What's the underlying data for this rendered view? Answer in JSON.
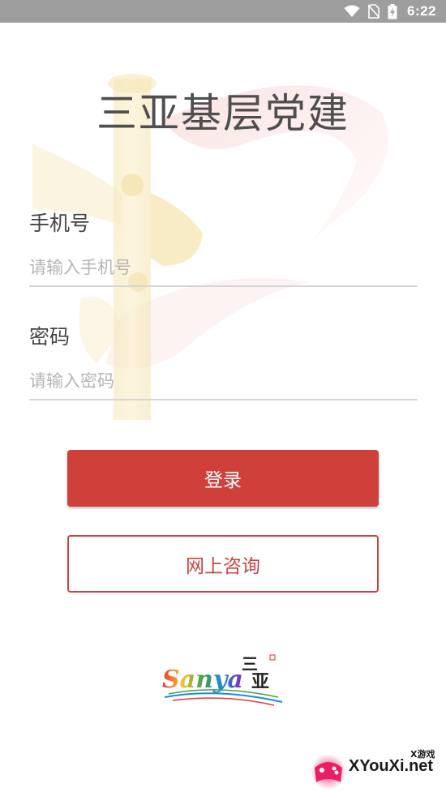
{
  "status_bar": {
    "time": "6:22",
    "icons": [
      "wifi-icon",
      "no-sim-icon",
      "battery-charging-icon"
    ]
  },
  "app": {
    "title": "三亚基层党建"
  },
  "form": {
    "phone": {
      "label": "手机号",
      "placeholder": "请输入手机号",
      "value": ""
    },
    "password": {
      "label": "密码",
      "placeholder": "请输入密码",
      "value": ""
    }
  },
  "buttons": {
    "login_label": "登录",
    "consult_label": "网上咨询"
  },
  "logo": {
    "text": "Sanya",
    "chinese": "三亚"
  },
  "watermark": {
    "site": "XYouXi.net",
    "small": "X游戏"
  },
  "colors": {
    "primary_red": "#d0403b",
    "status_bar": "#9e9e9e",
    "title_gray": "#4f4f4f"
  }
}
